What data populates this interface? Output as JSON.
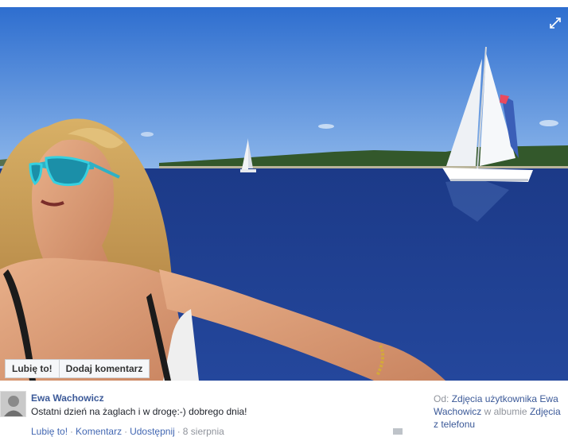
{
  "photo": {
    "expand_icon": "expand-arrows-icon",
    "colors": {
      "sky": "#2f6fcf",
      "sea": "#1f3f8f",
      "land": "#33582b",
      "sail": "#f4f6f8"
    }
  },
  "actions": {
    "like_label": "Lubię to!",
    "comment_label": "Dodaj komentarz"
  },
  "post": {
    "author": "Ewa Wachowicz",
    "caption": "Ostatni dzień na żaglach i w drogę:-) dobrego dnia!",
    "meta": {
      "like": "Lubię to!",
      "comment": "Komentarz",
      "share": "Udostępnij",
      "date": "8 sierpnia",
      "separator": "·"
    },
    "album": {
      "from_label": "Od:",
      "owner_link": "Zdjęcia użytkownika Ewa Wachowicz",
      "in_label": "w albumie",
      "album_link": "Zdjęcia z telefonu"
    }
  }
}
